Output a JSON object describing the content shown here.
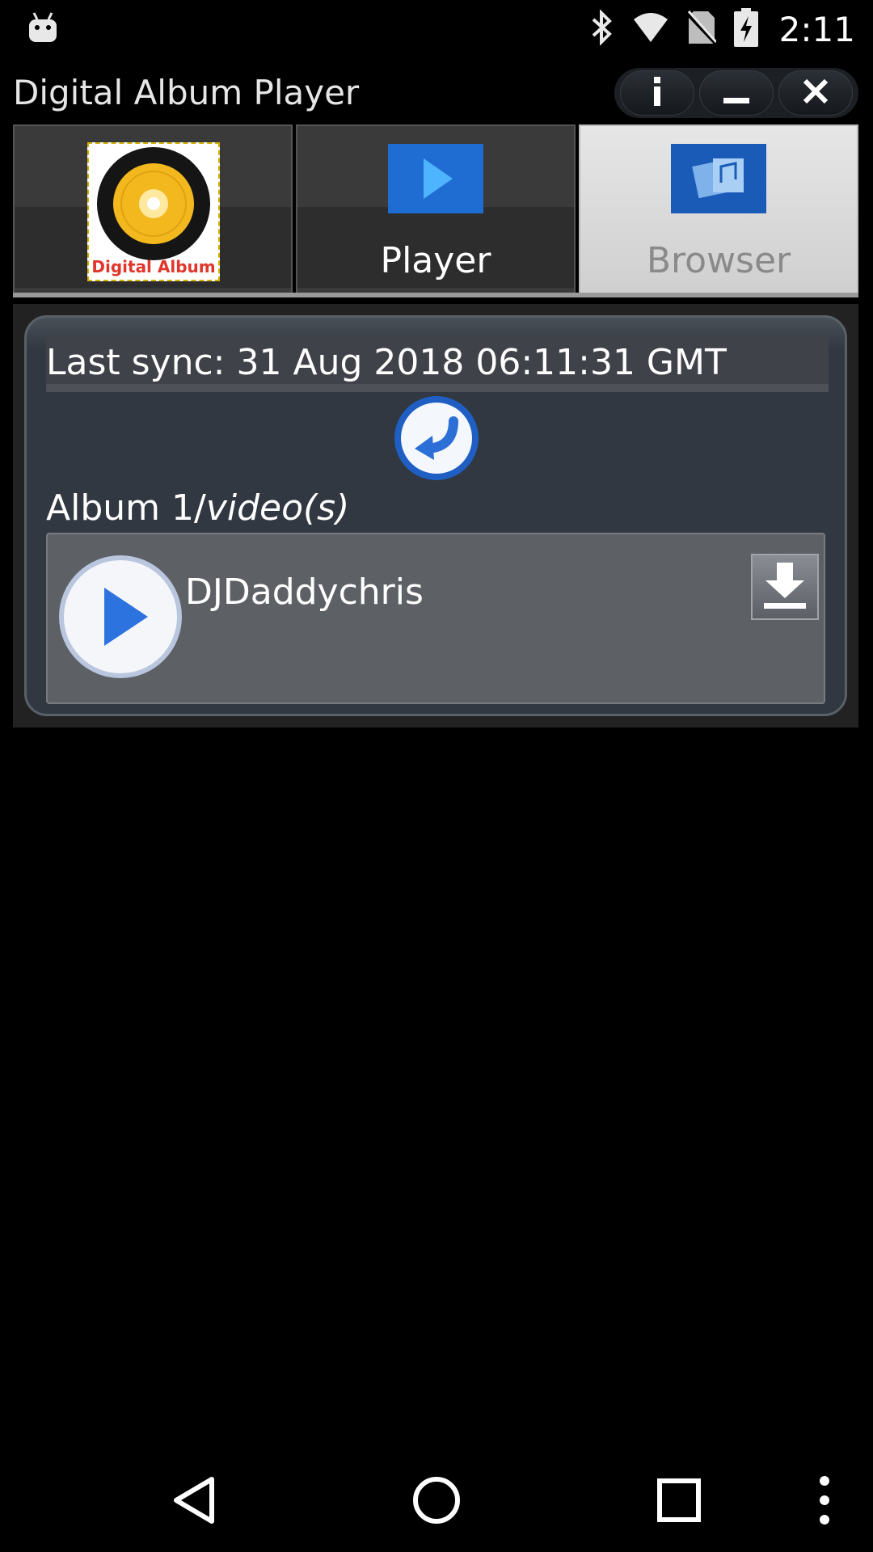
{
  "status_bar": {
    "time": "2:11",
    "icons": [
      "android-debug-icon",
      "bluetooth-icon",
      "wifi-icon",
      "no-sim-icon",
      "battery-charging-icon"
    ]
  },
  "app": {
    "title": "Digital Album Player",
    "window_controls": [
      "info-icon",
      "minimize-icon",
      "close-icon"
    ]
  },
  "tabs": [
    {
      "label": "",
      "icon": "digital-album-logo-icon",
      "logo_text": "Digital Album",
      "active": false
    },
    {
      "label": "Player",
      "icon": "play-icon",
      "active": false
    },
    {
      "label": "Browser",
      "icon": "browser-icon",
      "active": true
    }
  ],
  "browser": {
    "last_sync": "Last sync: 31 Aug 2018 06:11:31 GMT",
    "album_prefix": "Album 1/",
    "album_suffix": "video(s)",
    "items": [
      {
        "name": "DJDaddychris"
      }
    ]
  },
  "nav_bar": {
    "buttons": [
      "back-icon",
      "home-icon",
      "recents-icon",
      "more-icon"
    ]
  },
  "colors": {
    "accent_blue": "#2e6fd8",
    "logo_yellow": "#f2b81e",
    "active_tab_bg": "#dcdcdc"
  }
}
